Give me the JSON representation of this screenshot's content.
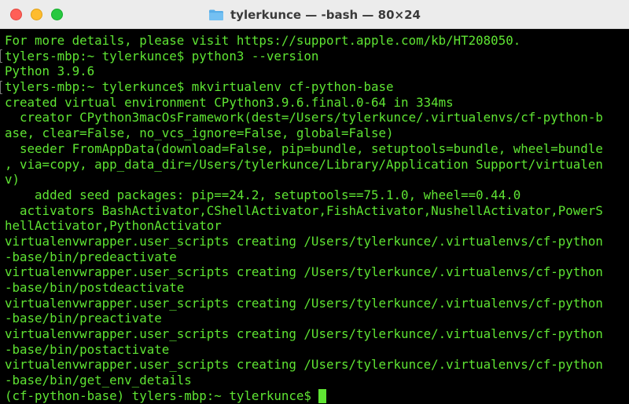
{
  "window": {
    "title": "tylerkunce — -bash — 80×24",
    "title_icon": "folder-icon"
  },
  "terminal": {
    "text_color": "#5fe533",
    "background_color": "#000000",
    "lines": [
      "For more details, please visit https://support.apple.com/kb/HT208050.",
      "tylers-mbp:~ tylerkunce$ python3 --version",
      "Python 3.9.6",
      "tylers-mbp:~ tylerkunce$ mkvirtualenv cf-python-base",
      "created virtual environment CPython3.9.6.final.0-64 in 334ms",
      "  creator CPython3macOsFramework(dest=/Users/tylerkunce/.virtualenvs/cf-python-b",
      "ase, clear=False, no_vcs_ignore=False, global=False)",
      "  seeder FromAppData(download=False, pip=bundle, setuptools=bundle, wheel=bundle",
      ", via=copy, app_data_dir=/Users/tylerkunce/Library/Application Support/virtualen",
      "v)",
      "    added seed packages: pip==24.2, setuptools==75.1.0, wheel==0.44.0",
      "  activators BashActivator,CShellActivator,FishActivator,NushellActivator,PowerS",
      "hellActivator,PythonActivator",
      "virtualenvwrapper.user_scripts creating /Users/tylerkunce/.virtualenvs/cf-python",
      "-base/bin/predeactivate",
      "virtualenvwrapper.user_scripts creating /Users/tylerkunce/.virtualenvs/cf-python",
      "-base/bin/postdeactivate",
      "virtualenvwrapper.user_scripts creating /Users/tylerkunce/.virtualenvs/cf-python",
      "-base/bin/preactivate",
      "virtualenvwrapper.user_scripts creating /Users/tylerkunce/.virtualenvs/cf-python",
      "-base/bin/postactivate",
      "virtualenvwrapper.user_scripts creating /Users/tylerkunce/.virtualenvs/cf-python",
      "-base/bin/get_env_details"
    ],
    "prompt": "(cf-python-base) tylers-mbp:~ tylerkunce$ "
  }
}
